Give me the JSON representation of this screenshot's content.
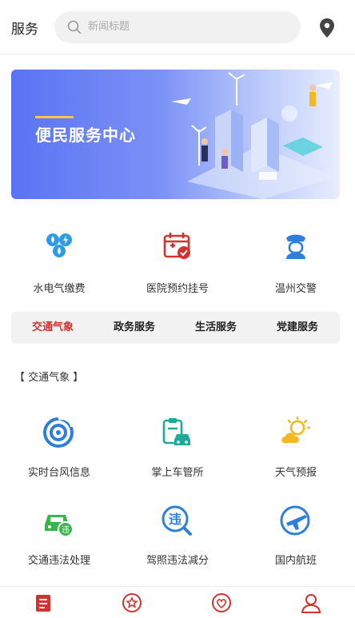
{
  "header": {
    "title": "服务"
  },
  "search": {
    "placeholder": "新闻标题"
  },
  "banner": {
    "title": "便民服务中心"
  },
  "quick": [
    {
      "label": "水电气缴费",
      "icon": "utility-icon"
    },
    {
      "label": "医院预约挂号",
      "icon": "hospital-calendar-icon"
    },
    {
      "label": "温州交警",
      "icon": "police-icon"
    }
  ],
  "tabs": [
    {
      "label": "交通气象",
      "active": true
    },
    {
      "label": "政务服务",
      "active": false
    },
    {
      "label": "生活服务",
      "active": false
    },
    {
      "label": "党建服务",
      "active": false
    }
  ],
  "section": {
    "title": "【 交通气象 】"
  },
  "services": [
    {
      "label": "实时台风信息",
      "icon": "typhoon-icon"
    },
    {
      "label": "掌上车管所",
      "icon": "vehicle-office-icon"
    },
    {
      "label": "天气预报",
      "icon": "weather-icon"
    },
    {
      "label": "交通违法处理",
      "icon": "car-violation-icon"
    },
    {
      "label": "驾照违法减分",
      "icon": "license-points-icon"
    },
    {
      "label": "国内航班",
      "icon": "flight-icon"
    }
  ],
  "colors": {
    "accent": "#d3322e",
    "blue": "#2e7fd9",
    "teal": "#1fa99a",
    "green": "#3ab54a",
    "yellow": "#f5b820"
  }
}
